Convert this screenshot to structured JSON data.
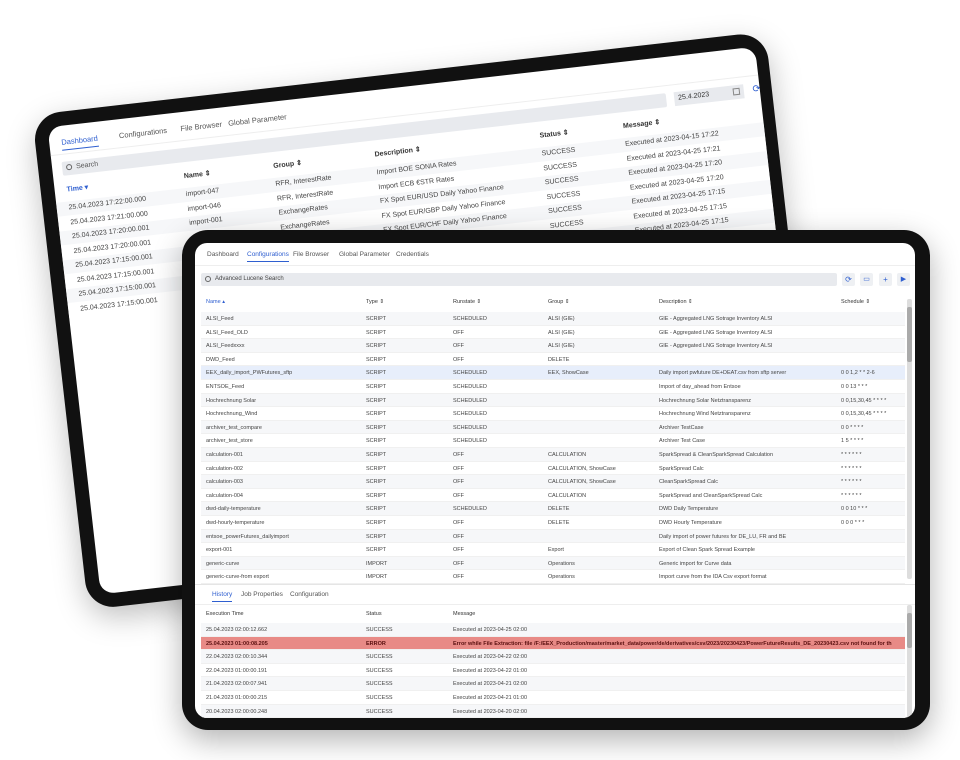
{
  "back": {
    "tabs": [
      "Dashboard",
      "Configurations",
      "File Browser",
      "Global Parameter"
    ],
    "search_placeholder": "Search",
    "date": "25.4.2023",
    "headers": {
      "time": "Time ▾",
      "name": "Name ⇕",
      "group": "Group ⇕",
      "description": "Description ⇕",
      "status": "Status ⇕",
      "message": "Message ⇕"
    },
    "rows": [
      {
        "time": "25.04.2023 17:22:00.000",
        "name": "import-047",
        "group": "RFR, InterestRate",
        "description": "Import BOE SONIA Rates",
        "status": "SUCCESS",
        "message": "Executed at 2023-04-15 17:22"
      },
      {
        "time": "25.04.2023 17:21:00.000",
        "name": "import-046",
        "group": "RFR, InterestRate",
        "description": "Import ECB €STR Rates",
        "status": "SUCCESS",
        "message": "Executed at 2023-04-25 17:21"
      },
      {
        "time": "25.04.2023 17:20:00.001",
        "name": "import-001",
        "group": "ExchangeRates",
        "description": "FX Spot EUR/USD Daily Yahoo Finance",
        "status": "SUCCESS",
        "message": "Executed at 2023-04-25 17:20"
      },
      {
        "time": "25.04.2023 17:20:00.001",
        "name": "",
        "group": "ExchangeRates",
        "description": "FX Spot EUR/GBP Daily Yahoo Finance",
        "status": "SUCCESS",
        "message": "Executed at 2023-04-25 17:20"
      },
      {
        "time": "25.04.2023 17:15:00.001",
        "name": "",
        "group": "",
        "description": "FX Spot EUR/CHF Daily Yahoo Finance",
        "status": "SUCCESS",
        "message": "Executed at 2023-04-25 17:15"
      },
      {
        "time": "25.04.2023 17:15:00.001",
        "name": "",
        "group": "",
        "description": "",
        "status": "SUCCESS",
        "message": "Executed at 2023-04-25 17:15"
      },
      {
        "time": "25.04.2023 17:15:00.001",
        "name": "",
        "group": "",
        "description": "",
        "status": "",
        "message": "Executed at 2023-04-25 17:15"
      },
      {
        "time": "25.04.2023 17:15:00.001",
        "name": "",
        "group": "",
        "description": "",
        "status": "",
        "message": ""
      }
    ]
  },
  "front": {
    "tabs": [
      "Dashboard",
      "Configurations",
      "File Browser",
      "Global Parameter",
      "Credentials"
    ],
    "search_placeholder": "Advanced Lucene Search",
    "icons": [
      "refresh-icon",
      "folder-icon",
      "plus-icon",
      "play-icon"
    ],
    "headers": {
      "name": "Name ▴",
      "type": "Type ⇕",
      "runstate": "Runstate ⇕",
      "group": "Group ⇕",
      "description": "Description ⇕",
      "schedule": "Schedule ⇕"
    },
    "rows": [
      [
        "ALSI_Feed",
        "SCRIPT",
        "SCHEDULED",
        "ALSI (GIE)",
        "GIE - Aggregated LNG Sotrage Inventory ALSI",
        ""
      ],
      [
        "ALSI_Feed_OLD",
        "SCRIPT",
        "OFF",
        "ALSI (GIE)",
        "GIE - Aggregated LNG Sotrage Inventory ALSI",
        ""
      ],
      [
        "ALSI_Feedxxxx",
        "SCRIPT",
        "OFF",
        "ALSI (GIE)",
        "GIE - Aggregated LNG Sotrage Inventory ALSI",
        ""
      ],
      [
        "DWD_Feed",
        "SCRIPT",
        "OFF",
        "DELETE",
        "",
        ""
      ],
      [
        "EEX_daily_import_PWFutures_sftp",
        "SCRIPT",
        "SCHEDULED",
        "EEX, ShowCase",
        "Daily import pwfuture DE+DEAT.csv from sftp server",
        "0 0 1,2 * * 2-6"
      ],
      [
        "ENTSOE_Feed",
        "SCRIPT",
        "SCHEDULED",
        "",
        "Import of day_ahead from Entsoe",
        "0 0 13 * * *"
      ],
      [
        "Hochrechnung Solar",
        "SCRIPT",
        "SCHEDULED",
        "",
        "Hochrechnung Solar Netztransparenz",
        "0 0,15,30,45 * * * *"
      ],
      [
        "Hochrechnung_Wind",
        "SCRIPT",
        "SCHEDULED",
        "",
        "Hochrechnung Wind Netztransparenz",
        "0 0,15,30,45 * * * *"
      ],
      [
        "archiver_test_compare",
        "SCRIPT",
        "SCHEDULED",
        "",
        "Archiver TestCase",
        "0 0 * * * *"
      ],
      [
        "archiver_test_store",
        "SCRIPT",
        "SCHEDULED",
        "",
        "Archiver Test Case",
        "1 5 * * * *"
      ],
      [
        "calculation-001",
        "SCRIPT",
        "OFF",
        "CALCULATION",
        "SparkSpread & CleanSparkSpread Calculation",
        "* * * * * *"
      ],
      [
        "calculation-002",
        "SCRIPT",
        "OFF",
        "CALCULATION, ShowCase",
        "SparkSpread Calc",
        "* * * * * *"
      ],
      [
        "calculation-003",
        "SCRIPT",
        "OFF",
        "CALCULATION, ShowCase",
        "CleanSparkSpread Calc",
        "* * * * * *"
      ],
      [
        "calculation-004",
        "SCRIPT",
        "OFF",
        "CALCULATION",
        "SparkSpread and CleanSparkSpread Calc",
        "* * * * * *"
      ],
      [
        "dwd-daily-temperature",
        "SCRIPT",
        "SCHEDULED",
        "DELETE",
        "DWD Daily Temperature",
        "0 0 10 * * *"
      ],
      [
        "dwd-hourly-temperature",
        "SCRIPT",
        "OFF",
        "DELETE",
        "DWD Hourly Temperature",
        "0 0 0 * * *"
      ],
      [
        "entsoe_powerFutures_dailyimport",
        "SCRIPT",
        "OFF",
        "",
        "Daily import of power futures for DE_LU, FR and BE",
        ""
      ],
      [
        "export-001",
        "SCRIPT",
        "OFF",
        "Export",
        "Export of Clean Spark Spread Example",
        ""
      ],
      [
        "generic-curve",
        "IMPORT",
        "OFF",
        "Operations",
        "Generic import for Curve data",
        ""
      ],
      [
        "generic-curve-from export",
        "IMPORT",
        "OFF",
        "Operations",
        "Import curve from the IDA Csv export format",
        ""
      ]
    ],
    "selected_row": 4,
    "detail_tabs": [
      "History",
      "Job Properties",
      "Configuration"
    ],
    "history_headers": {
      "time": "Execution Time",
      "status": "Status",
      "message": "Message"
    },
    "history": [
      [
        "25.04.2023 02:00:12.662",
        "SUCCESS",
        "Executed at 2023-04-25 02:00"
      ],
      [
        "25.04.2023 01:00:08.205",
        "ERROR",
        "Error while File Extraction: file /F:/EEX_Production/master/market_data/power/de/derivatives/csv/2023/20230423/PowerFutureResults_DE_20230423.csv not found for th"
      ],
      [
        "22.04.2023 02:00:10.344",
        "SUCCESS",
        "Executed at 2023-04-22 02:00"
      ],
      [
        "22.04.2023 01:00:00.191",
        "SUCCESS",
        "Executed at 2023-04-22 01:00"
      ],
      [
        "21.04.2023 02:00:07.941",
        "SUCCESS",
        "Executed at 2023-04-21 02:00"
      ],
      [
        "21.04.2023 01:00:00.215",
        "SUCCESS",
        "Executed at 2023-04-21 01:00"
      ],
      [
        "20.04.2023 02:00:00.248",
        "SUCCESS",
        "Executed at 2023-04-20 02:00"
      ]
    ],
    "colors": {
      "accent": "#2f5fd0",
      "error_row": "#e88a86",
      "selected_row": "#e7eefb"
    }
  }
}
